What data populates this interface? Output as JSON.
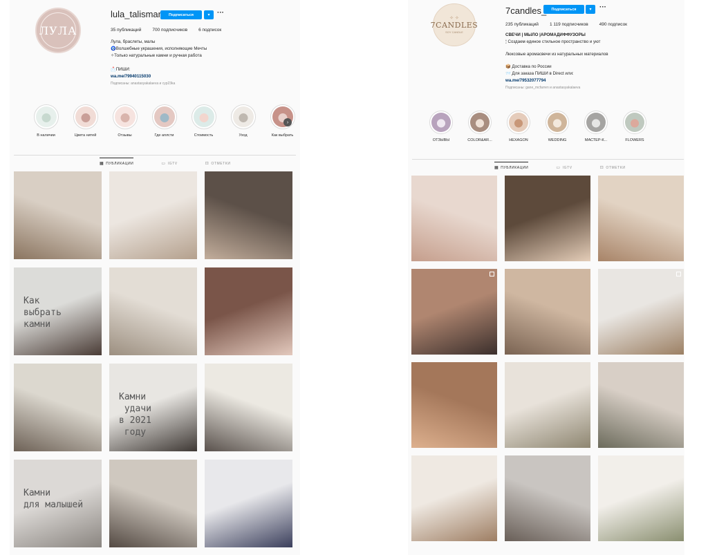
{
  "profile1": {
    "username": "lula_talisman",
    "follow_label": "Подписаться",
    "more_label": "···",
    "stats": [
      "35 публикаций",
      "700 подписчиков",
      "6 подписок"
    ],
    "bio": [
      "Лула, браслеты, малы",
      "🧿Волшебные украшения, исполняющие Мечты",
      "✧Только натуральные камни и ручная работа",
      "",
      "📩ПИШИ:",
      "wa.me/79940115030"
    ],
    "followed_by": "Подписаны: anastasyakalaeva и cyp23ka",
    "logo_text": "ЛУЛА",
    "highlights": [
      {
        "label": "В наличии",
        "color": "#e7f0ec",
        "accent": "#c7d9cf"
      },
      {
        "label": "Цвета нитей",
        "color": "#f1dcd6",
        "accent": "#c99f98"
      },
      {
        "label": "Отзывы",
        "color": "#f6e3df",
        "accent": "#d9b4ac"
      },
      {
        "label": "Где аплсти",
        "color": "#e4c8c2",
        "accent": "#9fb9c7"
      },
      {
        "label": "Стоимость",
        "color": "#dcebe8",
        "accent": "#f2d6ce"
      },
      {
        "label": "Уход",
        "color": "#eeeae5",
        "accent": "#bfb8b0"
      },
      {
        "label": "Как выбрать",
        "color": "#c79289",
        "accent": "#e9d0cb"
      }
    ],
    "tabs": [
      "ПУБЛИКАЦИИ",
      "IGTV",
      "ОТМЕТКИ"
    ],
    "posts": [
      {
        "colors": [
          "#d9cfc4",
          "#8b7560"
        ],
        "caption": ""
      },
      {
        "colors": [
          "#ece6e0",
          "#b4a08d"
        ],
        "caption": ""
      },
      {
        "colors": [
          "#5c5048",
          "#c2ad9b"
        ],
        "caption": ""
      },
      {
        "colors": [
          "#dcdcd9",
          "#4a3c36"
        ],
        "caption": "Как\nвыбрать\nкамни"
      },
      {
        "colors": [
          "#e3ddd5",
          "#9c8f80"
        ],
        "caption": ""
      },
      {
        "colors": [
          "#7a5549",
          "#e3c9bd"
        ],
        "caption": ""
      },
      {
        "colors": [
          "#dcd8cf",
          "#6e6257"
        ],
        "caption": ""
      },
      {
        "colors": [
          "#e8e6e2",
          "#3e3834"
        ],
        "caption": "Камни\n удачи\nв 2021\n году"
      },
      {
        "colors": [
          "#ece9e2",
          "#5a524d"
        ],
        "caption": ""
      },
      {
        "colors": [
          "#dcd9d6",
          "#8a8580"
        ],
        "caption": "Камни\nдля малышей"
      },
      {
        "colors": [
          "#cfc8bf",
          "#544a43"
        ],
        "caption": ""
      },
      {
        "colors": [
          "#e8e8eb",
          "#3b3f5c"
        ],
        "caption": ""
      }
    ]
  },
  "profile2": {
    "username": "7candles_",
    "follow_label": "Подписаться",
    "more_label": "···",
    "stats": [
      "235 публикаций",
      "1 119 подписчиков",
      "490 подписок"
    ],
    "bio": [
      "СВЕЧИ | МЫЛО |АРОМАДИФФУЗОРЫ",
      "🕯 Создаем единое стильное пространство и уют",
      "",
      "Люксовые аромасвечи из натуральных материалов",
      "",
      "📦 Доставка по России",
      "📨 Для заказа ПИШИ в Direct или:",
      "wa.me/79532077794"
    ],
    "followed_by": "Подписаны: gane_mcfarren и anastasyakalaeva",
    "logo_text": "7CANDLES",
    "logo_sub": "SOY CANDLE",
    "logo_mark": "✧ ✧",
    "highlights": [
      {
        "label": "ОТЗЫВЫ",
        "color": "#b8a3bd",
        "accent": "#efe8f1"
      },
      {
        "label": "COLOR&AR...",
        "color": "#a98e80",
        "accent": "#efe1d6"
      },
      {
        "label": "HEXAGON",
        "color": "#e5ccbb",
        "accent": "#c89778"
      },
      {
        "label": "WEDDING",
        "color": "#cfb59a",
        "accent": "#f3e9dd"
      },
      {
        "label": "МАСТЕР-К...",
        "color": "#a5a4a2",
        "accent": "#e6e6e5"
      },
      {
        "label": "FLOWERS",
        "color": "#bfc9bf",
        "accent": "#dca99c"
      }
    ],
    "tabs": [
      "ПУБЛИКАЦИИ",
      "IGTV",
      "ОТМЕТКИ"
    ],
    "posts": [
      {
        "colors": [
          "#e8d8cf",
          "#c59e8c"
        ],
        "caption": ""
      },
      {
        "colors": [
          "#5d4a3b",
          "#e4cdb8"
        ],
        "caption": ""
      },
      {
        "colors": [
          "#e2d3c3",
          "#a88468"
        ],
        "caption": ""
      },
      {
        "colors": [
          "#b08670",
          "#3b2f2c"
        ],
        "caption": ""
      },
      {
        "colors": [
          "#cfb7a1",
          "#7a6352"
        ],
        "caption": ""
      },
      {
        "colors": [
          "#e9e6e2",
          "#9c8064"
        ],
        "caption": ""
      },
      {
        "colors": [
          "#a4775a",
          "#ddb08e"
        ],
        "caption": ""
      },
      {
        "colors": [
          "#e8e2da",
          "#8e8671"
        ],
        "caption": ""
      },
      {
        "colors": [
          "#d8cfc6",
          "#6c6b5c"
        ],
        "caption": ""
      },
      {
        "colors": [
          "#efe9e2",
          "#9e7e63"
        ],
        "caption": ""
      },
      {
        "colors": [
          "#c9c5c1",
          "#695f58"
        ],
        "caption": ""
      },
      {
        "colors": [
          "#f2efea",
          "#8a8f70"
        ],
        "caption": ""
      }
    ]
  },
  "colors": {
    "accent": "#0095f6",
    "link": "#00376b",
    "muted": "#8e8e8e"
  }
}
